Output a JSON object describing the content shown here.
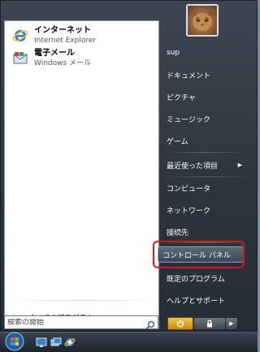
{
  "pinned": [
    {
      "title": "インターネット",
      "subtitle": "Internet Explorer",
      "icon": "internet-explorer-icon"
    },
    {
      "title": "電子メール",
      "subtitle": "Windows メール",
      "icon": "mail-icon"
    }
  ],
  "all_programs": {
    "label": "すべてのプログラム",
    "arrow": "▶"
  },
  "search": {
    "placeholder": "検索の開始"
  },
  "user": {
    "avatar": "cat-photo-avatar"
  },
  "right_items": [
    {
      "label": "sup"
    },
    {
      "label": "ドキュメント"
    },
    {
      "label": "ピクチャ"
    },
    {
      "label": "ミュージック"
    },
    {
      "label": "ゲーム"
    },
    {
      "label": "最近使った項目",
      "arrow": "▶"
    },
    {
      "label": "コンピュータ"
    },
    {
      "label": "ネットワーク"
    },
    {
      "label": "接続先"
    },
    {
      "label": "コントロール パネル"
    },
    {
      "label": "既定のプログラム"
    },
    {
      "label": "ヘルプとサポート"
    }
  ],
  "bottom_buttons": {
    "arrow": "▶"
  },
  "colors": {
    "highlight_ring": "#d4191c",
    "power": "#e0a824",
    "menu_bg": "#2c343d"
  }
}
